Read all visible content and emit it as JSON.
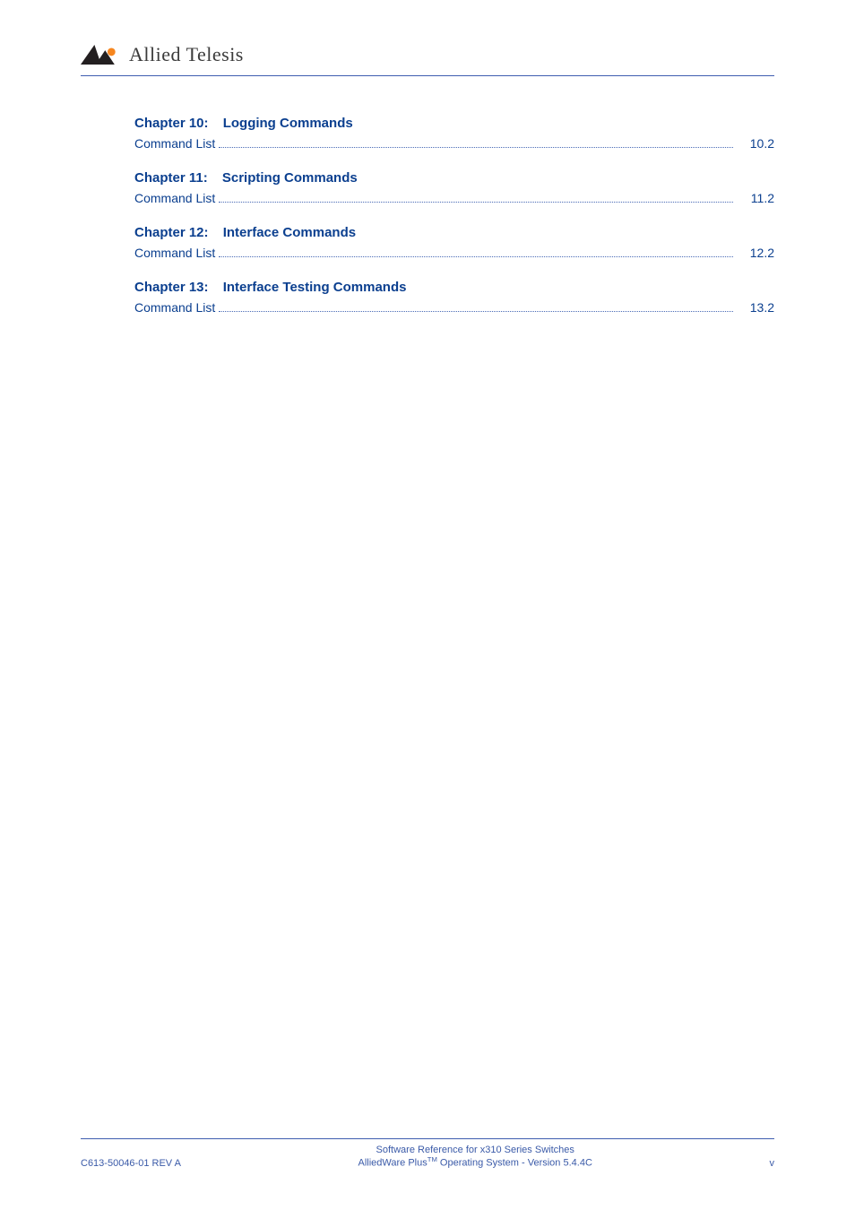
{
  "brand": {
    "name": "Allied Telesis"
  },
  "toc": [
    {
      "chapter_num": "Chapter 10:",
      "chapter_title": "Logging Commands",
      "entries": [
        {
          "label": "Command List",
          "page": "10.2"
        }
      ]
    },
    {
      "chapter_num": "Chapter 11:",
      "chapter_title": "Scripting Commands",
      "entries": [
        {
          "label": "Command List",
          "page": "11.2"
        }
      ]
    },
    {
      "chapter_num": "Chapter 12:",
      "chapter_title": "Interface Commands",
      "entries": [
        {
          "label": "Command List",
          "page": "12.2"
        }
      ]
    },
    {
      "chapter_num": "Chapter 13:",
      "chapter_title": "Interface Testing Commands",
      "entries": [
        {
          "label": "Command List",
          "page": "13.2"
        }
      ]
    }
  ],
  "footer": {
    "left": "C613-50046-01 REV A",
    "center_line1": "Software Reference for x310 Series Switches",
    "center_line2_prefix": "AlliedWare Plus",
    "center_line2_tm": "TM",
    "center_line2_suffix": " Operating System - Version 5.4.4C",
    "right": "v"
  }
}
